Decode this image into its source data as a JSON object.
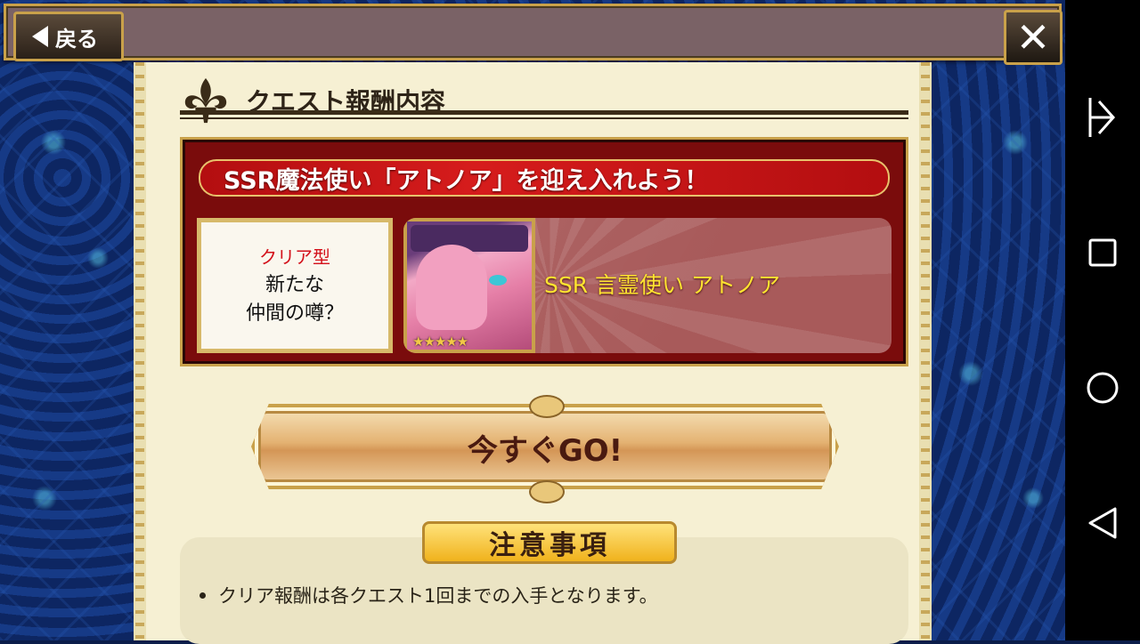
{
  "header": {
    "back_label": "戻る"
  },
  "panel": {
    "title": "クエスト報酬内容",
    "mission": {
      "banner": "SSR魔法使い「アトノア」を迎え入れよう！",
      "clear_type": "クリア型",
      "clear_name_line1": "新たな",
      "clear_name_line2": "仲間の噂？",
      "reward": {
        "name": "SSR 言霊使い アトノア",
        "rarity_stars": "★★★★★",
        "rarity": 5
      }
    },
    "go_button": "今すぐGO!",
    "notes": {
      "title": "注意事項",
      "items": [
        "クリア報酬は各クエスト1回までの入手となります。"
      ]
    }
  },
  "colors": {
    "accent_gold": "#c9a14a",
    "banner_red": "#d61c1c",
    "reward_name": "#ffe430",
    "clear_type": "#d3101a"
  },
  "icons": [
    "back-arrow-icon",
    "close-icon",
    "fleur-de-lis-icon",
    "nav-recent-icon",
    "nav-square-icon",
    "nav-home-icon",
    "nav-back-icon"
  ]
}
